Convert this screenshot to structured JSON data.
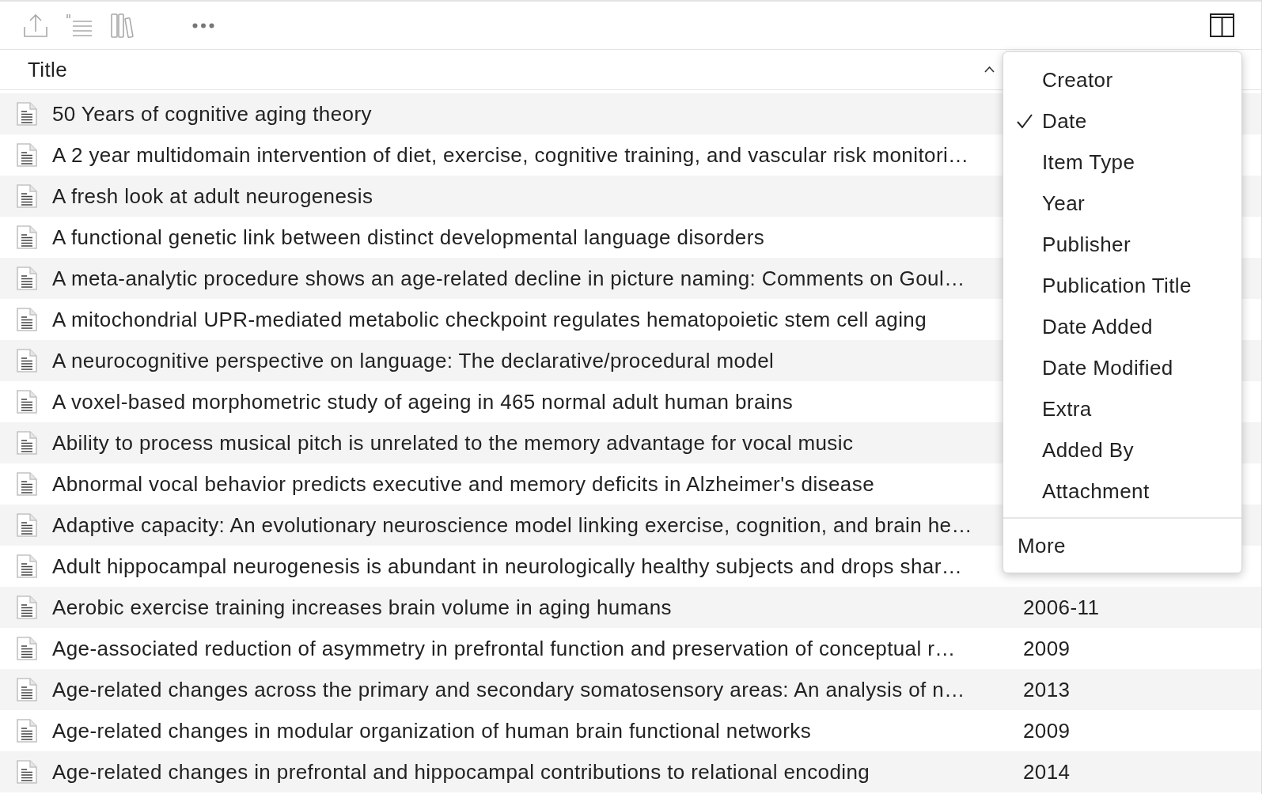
{
  "table": {
    "columns": [
      {
        "label": "Title",
        "sorted_ascending": true
      }
    ],
    "rows": [
      {
        "title": "50 Years of cognitive aging theory"
      },
      {
        "title": "A 2 year multidomain intervention of diet, exercise, cognitive training, and vascular risk monitori…"
      },
      {
        "title": "A fresh look at adult neurogenesis"
      },
      {
        "title": "A functional genetic link between distinct developmental language disorders"
      },
      {
        "title": "A meta-analytic procedure shows an age-related decline in picture naming: Comments on Goul…"
      },
      {
        "title": "A mitochondrial UPR-mediated metabolic checkpoint regulates hematopoietic stem cell aging"
      },
      {
        "title": "A neurocognitive perspective on language: The declarative/procedural model"
      },
      {
        "title": "A voxel-based morphometric study of ageing in 465 normal adult human brains"
      },
      {
        "title": "Ability to process musical pitch is unrelated to the memory advantage for vocal music"
      },
      {
        "title": "Abnormal vocal behavior predicts executive and memory deficits in Alzheimer's disease"
      },
      {
        "title": "Adaptive capacity: An evolutionary neuroscience model linking exercise, cognition, and brain he…"
      },
      {
        "title": "Adult hippocampal neurogenesis is abundant in neurologically healthy subjects and drops shar…"
      },
      {
        "title": "Aerobic exercise training increases brain volume in aging humans",
        "column_2": "2006-11"
      },
      {
        "title": "Age-associated reduction of asymmetry in prefrontal function and preservation of conceptual r…",
        "column_2": "2009"
      },
      {
        "title": "Age-related changes across the primary and secondary somatosensory areas: An analysis of n…",
        "column_2": "2013"
      },
      {
        "title": "Age-related changes in modular organization of human brain functional networks",
        "column_2": "2009"
      },
      {
        "title": "Age-related changes in prefrontal and hippocampal contributions to relational encoding",
        "column_2": "2014"
      }
    ]
  },
  "column_menu": {
    "items": [
      {
        "label": "Creator",
        "checked": false
      },
      {
        "label": "Date",
        "checked": true
      },
      {
        "label": "Item Type",
        "checked": false
      },
      {
        "label": "Year",
        "checked": false
      },
      {
        "label": "Publisher",
        "checked": false
      },
      {
        "label": "Publication Title",
        "checked": false
      },
      {
        "label": "Date Added",
        "checked": false
      },
      {
        "label": "Date Modified",
        "checked": false
      },
      {
        "label": "Extra",
        "checked": false
      },
      {
        "label": "Added By",
        "checked": false
      },
      {
        "label": "Attachment",
        "checked": false
      }
    ],
    "more": "More"
  }
}
